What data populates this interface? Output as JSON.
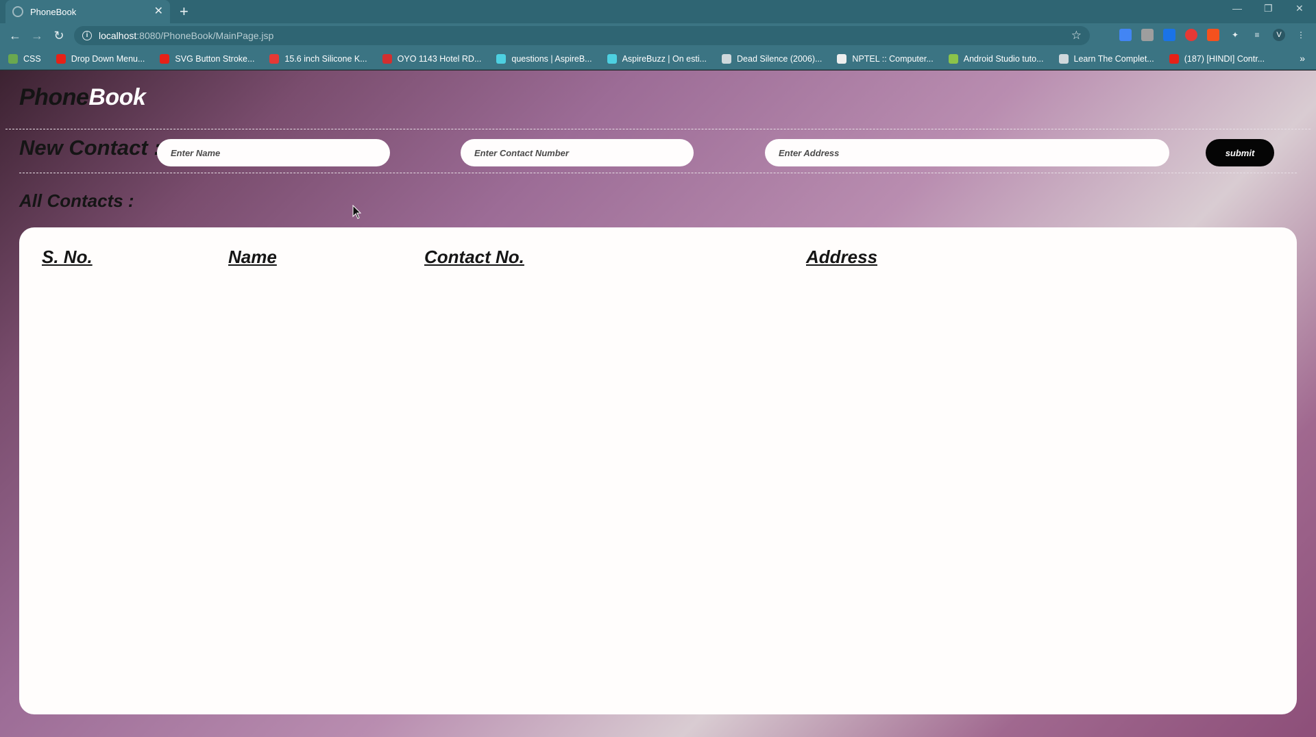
{
  "browser": {
    "tab": {
      "title": "PhoneBook",
      "close": "✕"
    },
    "new_tab": "+",
    "window_controls": {
      "minimize": "—",
      "restore": "❐",
      "close": "✕"
    },
    "nav": {
      "back": "←",
      "forward": "→",
      "reload": "↻"
    },
    "address": {
      "host": "localhost",
      "path": ":8080/PhoneBook/MainPage.jsp"
    },
    "star": "☆",
    "bookmarks": [
      {
        "label": "CSS",
        "icon": "css-icon",
        "color": "#6aa84f"
      },
      {
        "label": "Drop Down Menu...",
        "icon": "youtube-icon",
        "color": "#e62117"
      },
      {
        "label": "SVG Button Stroke...",
        "icon": "youtube-icon",
        "color": "#e62117"
      },
      {
        "label": "15.6 inch Silicone K...",
        "icon": "shop-icon",
        "color": "#e53935"
      },
      {
        "label": "OYO 1143 Hotel RD...",
        "icon": "oyo-icon",
        "color": "#d32f2f"
      },
      {
        "label": "questions | AspireB...",
        "icon": "aspire-icon",
        "color": "#4dd0e1"
      },
      {
        "label": "AspireBuzz | On esti...",
        "icon": "aspire-icon",
        "color": "#4dd0e1"
      },
      {
        "label": "Dead Silence (2006)...",
        "icon": "film-icon",
        "color": "#cfd8dc"
      },
      {
        "label": "NPTEL :: Computer...",
        "icon": "nptel-icon",
        "color": "#eeeeee"
      },
      {
        "label": "Android Studio tuto...",
        "icon": "android-icon",
        "color": "#8bc34a"
      },
      {
        "label": "Learn The Complet...",
        "icon": "globe-icon",
        "color": "#cfd8dc"
      },
      {
        "label": "(187) [HINDI] Contr...",
        "icon": "youtube-icon",
        "color": "#e62117"
      }
    ],
    "bookmarks_more": "»"
  },
  "app": {
    "logo_part1": "Phone",
    "logo_part2": "Book",
    "new_contact_label": "New Contact :",
    "name_placeholder": "Enter Name",
    "contact_placeholder": "Enter Contact Number",
    "address_placeholder": "Enter Address",
    "submit_label": "submit",
    "all_contacts_label": "All Contacts :",
    "table_headers": {
      "sno": "S. No.",
      "name": "Name",
      "contact": "Contact No.",
      "address": "Address"
    },
    "rows": []
  }
}
